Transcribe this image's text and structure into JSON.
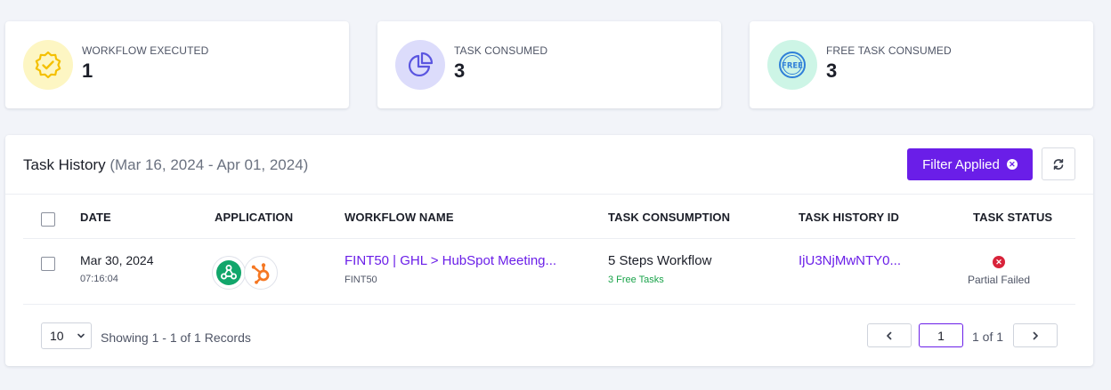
{
  "stats": [
    {
      "label": "WORKFLOW EXECUTED",
      "value": "1",
      "icon": "verified-badge-icon",
      "bg": "#fdf6c3",
      "color": "#f4c000"
    },
    {
      "label": "TASK CONSUMED",
      "value": "3",
      "icon": "pie-chart-icon",
      "bg": "#dcdcfb",
      "color": "#5a55e0"
    },
    {
      "label": "FREE TASK CONSUMED",
      "value": "3",
      "icon": "free-badge-icon",
      "bg": "#cdf5e6",
      "color": "#2f7fd8"
    }
  ],
  "history": {
    "title": "Task History",
    "range": "(Mar 16, 2024 - Apr 01, 2024)",
    "filter_label": "Filter Applied",
    "columns": [
      "DATE",
      "APPLICATION",
      "WORKFLOW NAME",
      "TASK CONSUMPTION",
      "TASK HISTORY ID",
      "TASK STATUS"
    ],
    "rows": [
      {
        "date": "Mar 30, 2024",
        "time": "07:16:04",
        "apps": [
          "webhook-icon",
          "hubspot-icon"
        ],
        "workflow_name": "FINT50 | GHL > HubSpot Meeting...",
        "workflow_sub": "FINT50",
        "consumption": "5 Steps Workflow",
        "free_tasks": "3 Free Tasks",
        "history_id": "IjU3NjMwNTY0...",
        "status": "Partial Failed"
      }
    ]
  },
  "pagination": {
    "per_page": "10",
    "showing": "Showing 1 - 1 of 1 Records",
    "current_page": "1",
    "of_pages": "1 of 1"
  },
  "colors": {
    "accent": "#6a1ee8",
    "success": "#1aa34a",
    "danger": "#d8233a"
  }
}
